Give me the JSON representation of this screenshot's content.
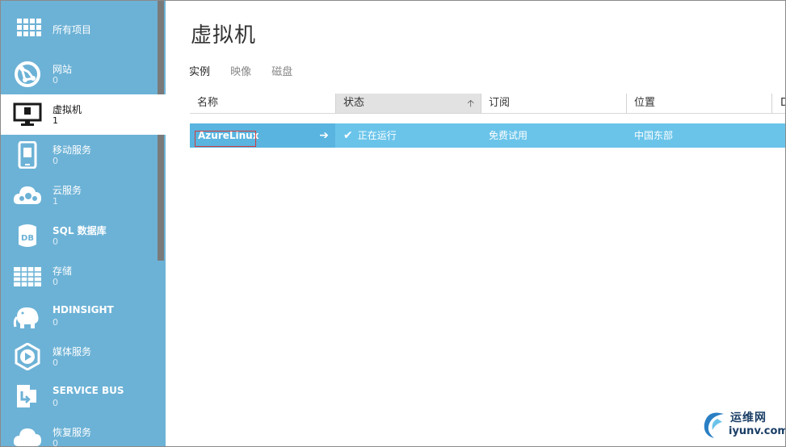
{
  "sidebar": {
    "items": [
      {
        "label": "所有项目",
        "count": "",
        "icon": "grid-icon"
      },
      {
        "label": "网站",
        "count": "0",
        "icon": "globe-icon"
      },
      {
        "label": "虚拟机",
        "count": "1",
        "icon": "monitor-icon"
      },
      {
        "label": "移动服务",
        "count": "0",
        "icon": "mobile-icon"
      },
      {
        "label": "云服务",
        "count": "1",
        "icon": "cloud-gear-icon"
      },
      {
        "label": "SQL 数据库",
        "count": "0",
        "icon": "database-icon"
      },
      {
        "label": "存储",
        "count": "0",
        "icon": "table-icon"
      },
      {
        "label": "HDINSIGHT",
        "count": "0",
        "icon": "elephant-icon"
      },
      {
        "label": "媒体服务",
        "count": "0",
        "icon": "media-icon"
      },
      {
        "label": "SERVICE BUS",
        "count": "0",
        "icon": "service-bus-icon"
      },
      {
        "label": "恢复服务",
        "count": "0",
        "icon": "recovery-icon"
      }
    ],
    "active_index": 2
  },
  "main": {
    "title": "虚拟机",
    "tabs": [
      {
        "label": "实例",
        "active": true
      },
      {
        "label": "映像",
        "active": false
      },
      {
        "label": "磁盘",
        "active": false
      }
    ],
    "columns": [
      "名称",
      "状态",
      "订阅",
      "位置",
      "D"
    ],
    "rows": [
      {
        "name": "AzureLinux",
        "status": "正在运行",
        "subscription": "免费试用",
        "location": "中国东部"
      }
    ]
  },
  "watermark": {
    "line1": "运维网",
    "line2": "iyunv.com"
  },
  "colors": {
    "sidebar": "#6cb2d6",
    "selected_row": "#6ac4ea",
    "selected_cell": "#59b4df"
  }
}
